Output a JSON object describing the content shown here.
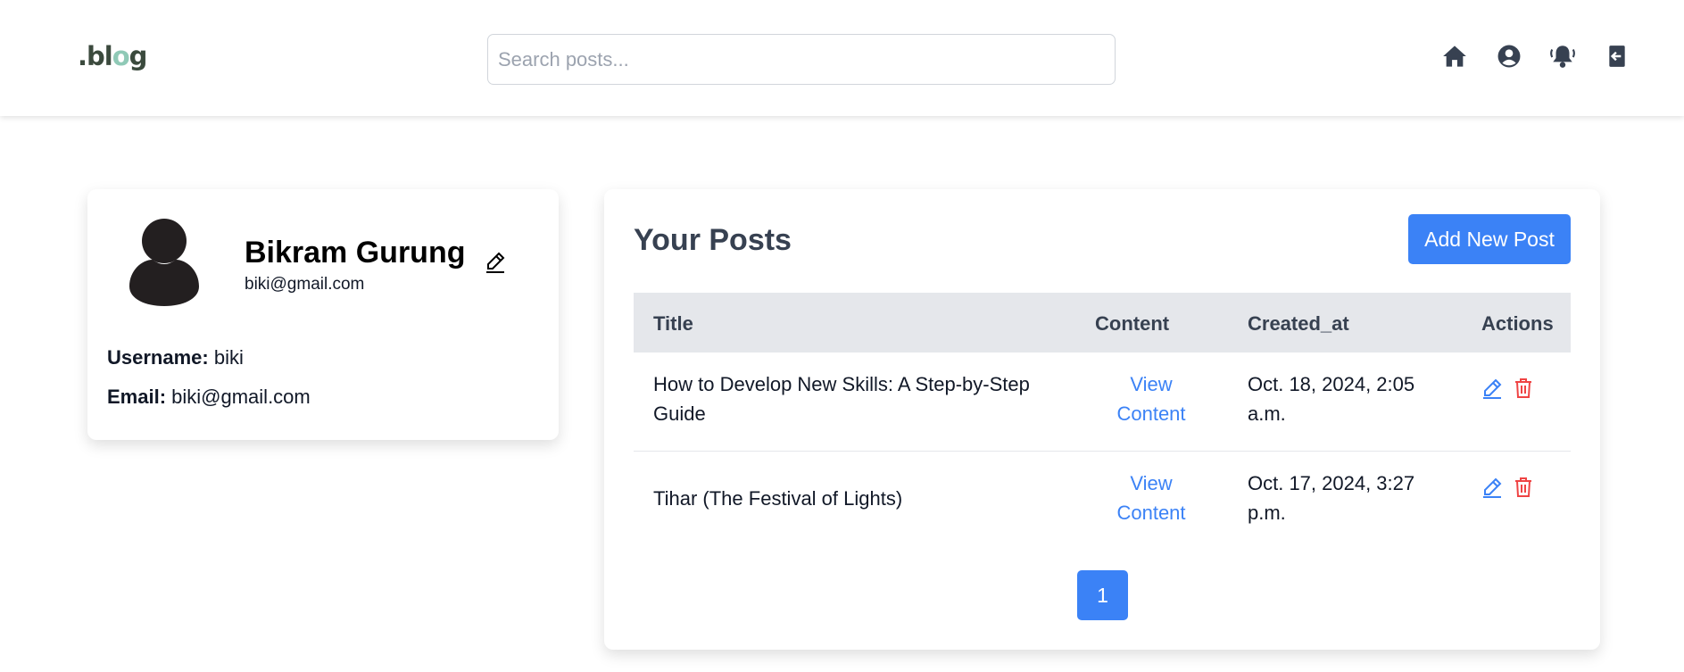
{
  "nav": {
    "logo_prefix": ".bl",
    "logo_o": "o",
    "logo_suffix": "g",
    "search_placeholder": "Search posts...",
    "icons": [
      "home-icon",
      "user-circle-icon",
      "bell-icon",
      "logout-icon"
    ]
  },
  "profile": {
    "name": "Bikram Gurung",
    "email": "biki@gmail.com",
    "username_label": "Username:",
    "username_value": "biki",
    "email_label": "Email:",
    "email_value": "biki@gmail.com"
  },
  "posts": {
    "title": "Your Posts",
    "add_button": "Add New Post",
    "columns": [
      "Title",
      "Content",
      "Created_at",
      "Actions"
    ],
    "rows": [
      {
        "title_line1": "How to Develop New Skills: A Step-by-Step",
        "title_line2": "Guide",
        "content_line1": "View",
        "content_line2": "Content",
        "created_line1": "Oct. 18, 2024, 2:05",
        "created_line2": "a.m."
      },
      {
        "title_line1": "Tihar (The Festival of Lights)",
        "content_line1": "View",
        "content_line2": "Content",
        "created_line1": "Oct. 17, 2024, 3:27",
        "created_line2": "p.m."
      }
    ],
    "current_page": "1"
  },
  "colors": {
    "primary": "#3b82f6",
    "danger": "#ef4444",
    "icon_dark": "#374151"
  }
}
